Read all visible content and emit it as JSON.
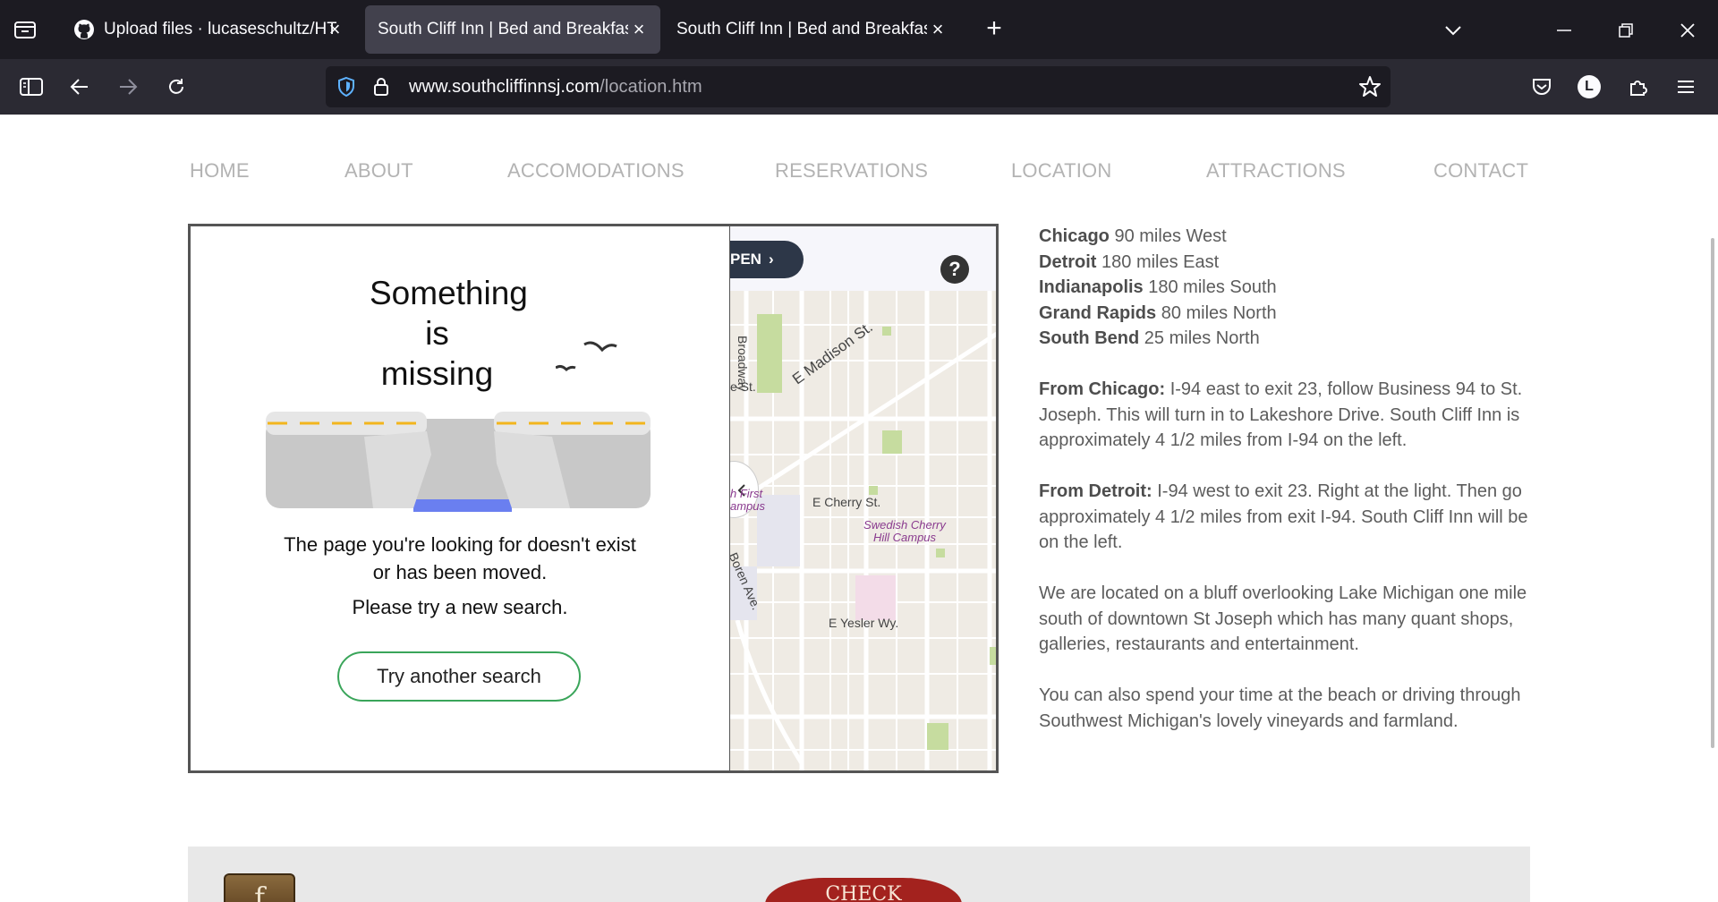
{
  "browser": {
    "tabs": [
      {
        "title": "Upload files · lucaseschultz/HTM",
        "active": false,
        "favicon": "github-icon"
      },
      {
        "title": "South Cliff Inn | Bed and Breakfast |",
        "active": true
      },
      {
        "title": "South Cliff Inn | Bed and Breakfast |",
        "active": false
      }
    ],
    "url_domain": "www.southcliffinnsj.com",
    "url_path": "/location.htm",
    "avatar_letter": "L"
  },
  "site": {
    "nav": [
      "HOME",
      "ABOUT",
      "ACCOMODATIONS",
      "RESERVATIONS",
      "LOCATION",
      "ATTRACTIONS",
      "CONTACT"
    ],
    "map_error": {
      "title_lines": [
        "Something",
        "is",
        "missing"
      ],
      "message": "The page you're looking for doesn't exist or has been moved.",
      "message2": "Please try a new search.",
      "button": "Try another search"
    },
    "map": {
      "open_label": "PEN",
      "help": "?",
      "labels": {
        "broadway": "Broadway",
        "e_madison": "E Madison St.",
        "e_st": "e St.",
        "first_campus": "h First\nampus",
        "e_cherry": "E Cherry St.",
        "swedish": "Swedish Cherry\nHill Campus",
        "boren": "Boren Ave.",
        "e_yesler": "E Yesler Wy."
      }
    },
    "distances": [
      {
        "city": "Chicago",
        "detail": "90 miles West"
      },
      {
        "city": "Detroit",
        "detail": "180 miles East"
      },
      {
        "city": "Indianapolis",
        "detail": "180 miles South"
      },
      {
        "city": "Grand Rapids",
        "detail": "80 miles North"
      },
      {
        "city": "South Bend",
        "detail": "25 miles North"
      }
    ],
    "directions": [
      {
        "label": "From Chicago:",
        "text": "I-94 east to exit 23, follow Business 94 to St. Joseph. This will turn in to Lakeshore Drive. South Cliff Inn is approximately 4 1/2 miles from I-94 on the left."
      },
      {
        "label": "From Detroit:",
        "text": "I-94 west to exit 23. Right at the light. Then go approximately 4 1/2 miles from exit I-94. South Cliff Inn will be on the left."
      }
    ],
    "paragraphs": [
      "We are located on a bluff overlooking Lake Michigan one mile south of downtown St Joseph which has many quant shops, galleries, restaurants and entertainment.",
      "You can also spend your time at the beach or driving through Southwest Michigan's lovely vineyards and farmland."
    ],
    "footer": {
      "facebook_letter": "f",
      "check_label": "CHECK"
    }
  }
}
